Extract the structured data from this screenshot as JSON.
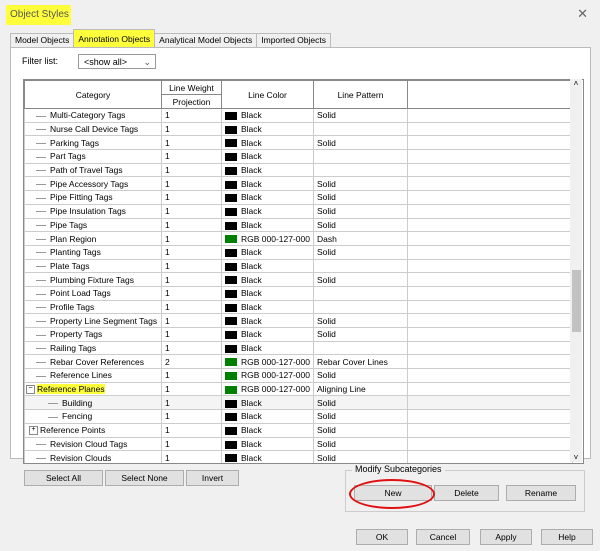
{
  "window": {
    "title": "Object Styles",
    "close": "✕"
  },
  "tabs": [
    "Model Objects",
    "Annotation Objects",
    "Analytical Model Objects",
    "Imported Objects"
  ],
  "active_tab": "Annotation Objects",
  "filter": {
    "label": "Filter list:",
    "value": "<show all>"
  },
  "table": {
    "headers": {
      "category": "Category",
      "line_weight": "Line Weight",
      "projection": "Projection",
      "line_color": "Line Color",
      "line_pattern": "Line Pattern"
    },
    "rows": [
      {
        "category": "Multi-Category Tags",
        "weight": "1",
        "color": "Black",
        "swatch": "#000000",
        "pattern": "Solid"
      },
      {
        "category": "Nurse Call Device Tags",
        "weight": "1",
        "color": "Black",
        "swatch": "#000000",
        "pattern": ""
      },
      {
        "category": "Parking Tags",
        "weight": "1",
        "color": "Black",
        "swatch": "#000000",
        "pattern": "Solid"
      },
      {
        "category": "Part Tags",
        "weight": "1",
        "color": "Black",
        "swatch": "#000000",
        "pattern": ""
      },
      {
        "category": "Path of Travel Tags",
        "weight": "1",
        "color": "Black",
        "swatch": "#000000",
        "pattern": ""
      },
      {
        "category": "Pipe Accessory Tags",
        "weight": "1",
        "color": "Black",
        "swatch": "#000000",
        "pattern": "Solid"
      },
      {
        "category": "Pipe Fitting Tags",
        "weight": "1",
        "color": "Black",
        "swatch": "#000000",
        "pattern": "Solid"
      },
      {
        "category": "Pipe Insulation Tags",
        "weight": "1",
        "color": "Black",
        "swatch": "#000000",
        "pattern": "Solid"
      },
      {
        "category": "Pipe Tags",
        "weight": "1",
        "color": "Black",
        "swatch": "#000000",
        "pattern": "Solid"
      },
      {
        "category": "Plan Region",
        "weight": "1",
        "color": "RGB 000-127-000",
        "swatch": "#007f00",
        "pattern": "Dash"
      },
      {
        "category": "Planting Tags",
        "weight": "1",
        "color": "Black",
        "swatch": "#000000",
        "pattern": "Solid"
      },
      {
        "category": "Plate Tags",
        "weight": "1",
        "color": "Black",
        "swatch": "#000000",
        "pattern": ""
      },
      {
        "category": "Plumbing Fixture Tags",
        "weight": "1",
        "color": "Black",
        "swatch": "#000000",
        "pattern": "Solid"
      },
      {
        "category": "Point Load Tags",
        "weight": "1",
        "color": "Black",
        "swatch": "#000000",
        "pattern": ""
      },
      {
        "category": "Profile Tags",
        "weight": "1",
        "color": "Black",
        "swatch": "#000000",
        "pattern": ""
      },
      {
        "category": "Property Line Segment Tags",
        "weight": "1",
        "color": "Black",
        "swatch": "#000000",
        "pattern": "Solid"
      },
      {
        "category": "Property Tags",
        "weight": "1",
        "color": "Black",
        "swatch": "#000000",
        "pattern": "Solid"
      },
      {
        "category": "Railing Tags",
        "weight": "1",
        "color": "Black",
        "swatch": "#000000",
        "pattern": ""
      },
      {
        "category": "Rebar Cover References",
        "weight": "2",
        "color": "RGB 000-127-000",
        "swatch": "#007f00",
        "pattern": "Rebar Cover Lines"
      },
      {
        "category": "Reference Lines",
        "weight": "1",
        "color": "RGB 000-127-000",
        "swatch": "#007f00",
        "pattern": "Solid"
      },
      {
        "category": "Reference Planes",
        "weight": "1",
        "color": "RGB 000-127-000",
        "swatch": "#007f00",
        "pattern": "Aligning Line",
        "expander": "−",
        "highlight": true
      },
      {
        "category": "Building",
        "weight": "1",
        "color": "Black",
        "swatch": "#000000",
        "pattern": "Solid",
        "child": true,
        "selected": true
      },
      {
        "category": "Fencing",
        "weight": "1",
        "color": "Black",
        "swatch": "#000000",
        "pattern": "Solid",
        "child": true
      },
      {
        "category": "Reference Points",
        "weight": "1",
        "color": "Black",
        "swatch": "#000000",
        "pattern": "Solid",
        "expander": "+"
      },
      {
        "category": "Revision Cloud Tags",
        "weight": "1",
        "color": "Black",
        "swatch": "#000000",
        "pattern": "Solid"
      },
      {
        "category": "Revision Clouds",
        "weight": "1",
        "color": "Black",
        "swatch": "#000000",
        "pattern": "Solid"
      }
    ]
  },
  "selection_buttons": {
    "select_all": "Select All",
    "select_none": "Select None",
    "invert": "Invert"
  },
  "modify": {
    "label": "Modify Subcategories",
    "new": "New",
    "delete": "Delete",
    "rename": "Rename"
  },
  "footer": {
    "ok": "OK",
    "cancel": "Cancel",
    "apply": "Apply",
    "help": "Help"
  },
  "colors": {
    "highlight": "#ffff3c",
    "annotation_ring": "#e01010"
  }
}
